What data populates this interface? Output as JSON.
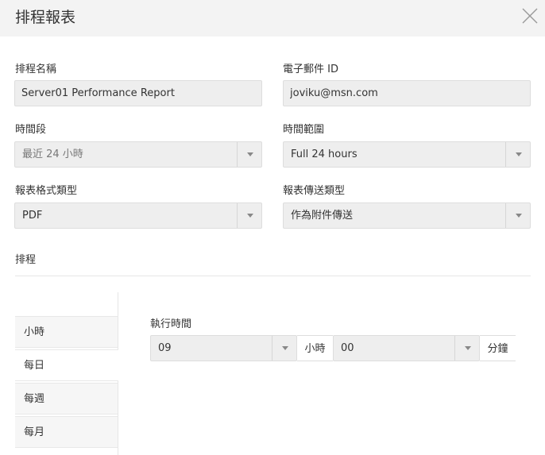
{
  "dialog": {
    "title": "排程報表"
  },
  "form": {
    "schedule_name": {
      "label": "排程名稱",
      "value": "Server01 Performance Report"
    },
    "email": {
      "label": "電子郵件 ID",
      "value": "joviku@msn.com"
    },
    "period": {
      "label": "時間段",
      "value": "最近 24 小時"
    },
    "time_range": {
      "label": "時間範圍",
      "value": "Full 24 hours"
    },
    "report_format": {
      "label": "報表格式類型",
      "value": "PDF"
    },
    "delivery_type": {
      "label": "報表傳送類型",
      "value": "作為附件傳送"
    }
  },
  "schedule": {
    "label": "排程",
    "tabs": [
      {
        "label": "小時"
      },
      {
        "label": "每日"
      },
      {
        "label": "每週"
      },
      {
        "label": "每月"
      }
    ],
    "active_tab": "每日",
    "run_time": {
      "label": "執行時間",
      "hour": "09",
      "hour_unit": "小時",
      "minute": "00",
      "minute_unit": "分鐘"
    }
  }
}
